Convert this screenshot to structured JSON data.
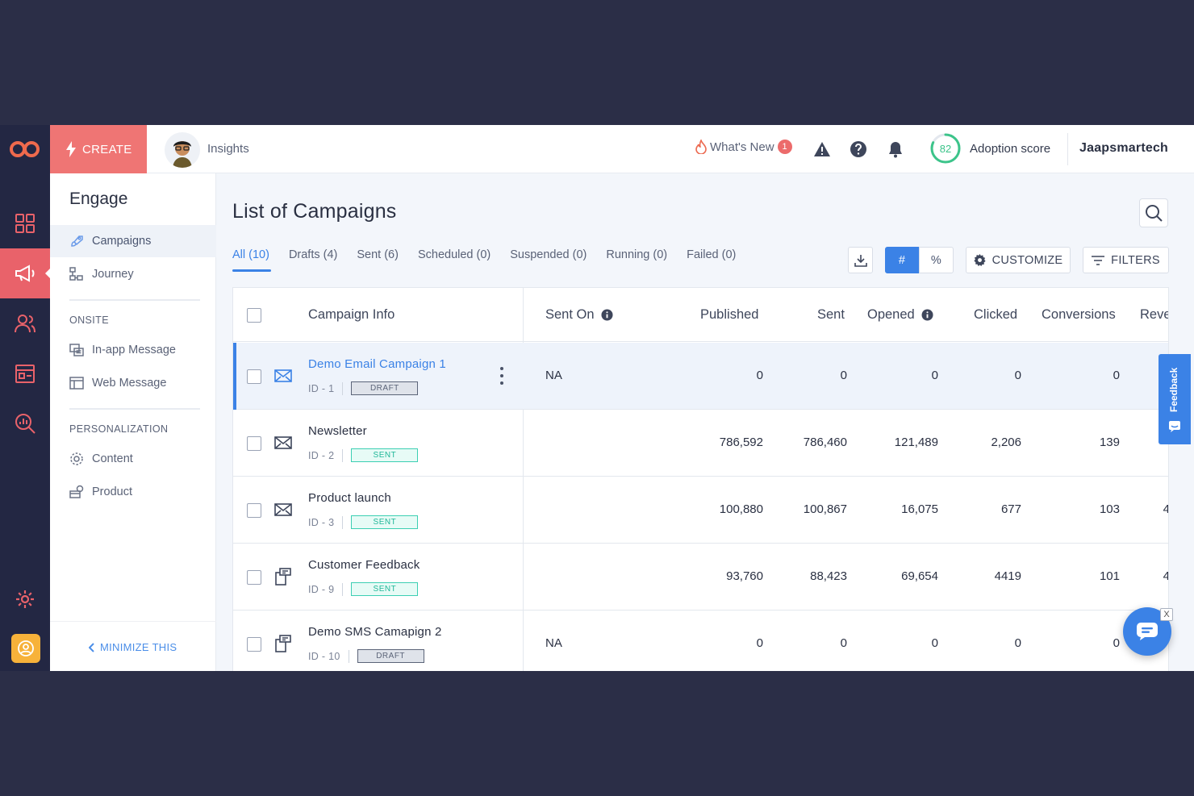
{
  "brand": {
    "accent": "#3b82e6",
    "create_color": "#ef7574",
    "rail_color": "#232743"
  },
  "topbar": {
    "create_label": "CREATE",
    "insights_label": "Insights",
    "whats_new_label": "What's New",
    "whats_new_count": "1",
    "adoption_score": "82",
    "adoption_label": "Adoption score",
    "org_name": "Jaapsmartech"
  },
  "nav": {
    "title": "Engage",
    "items": [
      {
        "label": "Campaigns",
        "icon": "rocket-icon"
      },
      {
        "label": "Journey",
        "icon": "flow-icon"
      }
    ],
    "onsite_heading": "ONSITE",
    "onsite_items": [
      {
        "label": "In-app Message",
        "icon": "chat-window-icon"
      },
      {
        "label": "Web Message",
        "icon": "browser-window-icon"
      }
    ],
    "personalization_heading": "PERSONALIZATION",
    "personalization_items": [
      {
        "label": "Content",
        "icon": "gear-content-icon"
      },
      {
        "label": "Product",
        "icon": "product-box-icon"
      }
    ],
    "minimize_label": "MINIMIZE THIS"
  },
  "main": {
    "title": "List of Campaigns",
    "tabs": [
      "All (10)",
      "Drafts (4)",
      "Sent (6)",
      "Scheduled (0)",
      "Suspended (0)",
      "Running (0)",
      "Failed (0)"
    ],
    "hash_label": "#",
    "percent_label": "%",
    "customize_label": "CUSTOMIZE",
    "filters_label": "FILTERS"
  },
  "table": {
    "headers": {
      "info": "Campaign Info",
      "sent_on": "Sent On",
      "published": "Published",
      "sent": "Sent",
      "opened": "Opened",
      "clicked": "Clicked",
      "conversions": "Conversions",
      "revenue": "Reve"
    },
    "rows": [
      {
        "name": "Demo Email Campaign 1",
        "id": "ID - 1",
        "status": "DRAFT",
        "channel": "email",
        "sent_on": "NA",
        "published": "0",
        "sent": "0",
        "opened": "0",
        "clicked": "0",
        "conversions": "0",
        "revenue": ""
      },
      {
        "name": "Newsletter",
        "id": "ID - 2",
        "status": "SENT",
        "channel": "email",
        "sent_on": "",
        "published": "786,592",
        "sent": "786,460",
        "opened": "121,489",
        "clicked": "2,206",
        "conversions": "139",
        "revenue": ""
      },
      {
        "name": "Product launch",
        "id": "ID - 3",
        "status": "SENT",
        "channel": "email",
        "sent_on": "",
        "published": "100,880",
        "sent": "100,867",
        "opened": "16,075",
        "clicked": "677",
        "conversions": "103",
        "revenue": "4"
      },
      {
        "name": "Customer Feedback",
        "id": "ID - 9",
        "status": "SENT",
        "channel": "web",
        "sent_on": "",
        "published": "93,760",
        "sent": "88,423",
        "opened": "69,654",
        "clicked": "4419",
        "conversions": "101",
        "revenue": "4"
      },
      {
        "name": "Demo SMS Camapign 2",
        "id": "ID - 10",
        "status": "DRAFT",
        "channel": "web",
        "sent_on": "NA",
        "published": "0",
        "sent": "0",
        "opened": "0",
        "clicked": "0",
        "conversions": "0",
        "revenue": ""
      }
    ]
  },
  "feedback_label": "Feedback",
  "chat_close_label": "X"
}
